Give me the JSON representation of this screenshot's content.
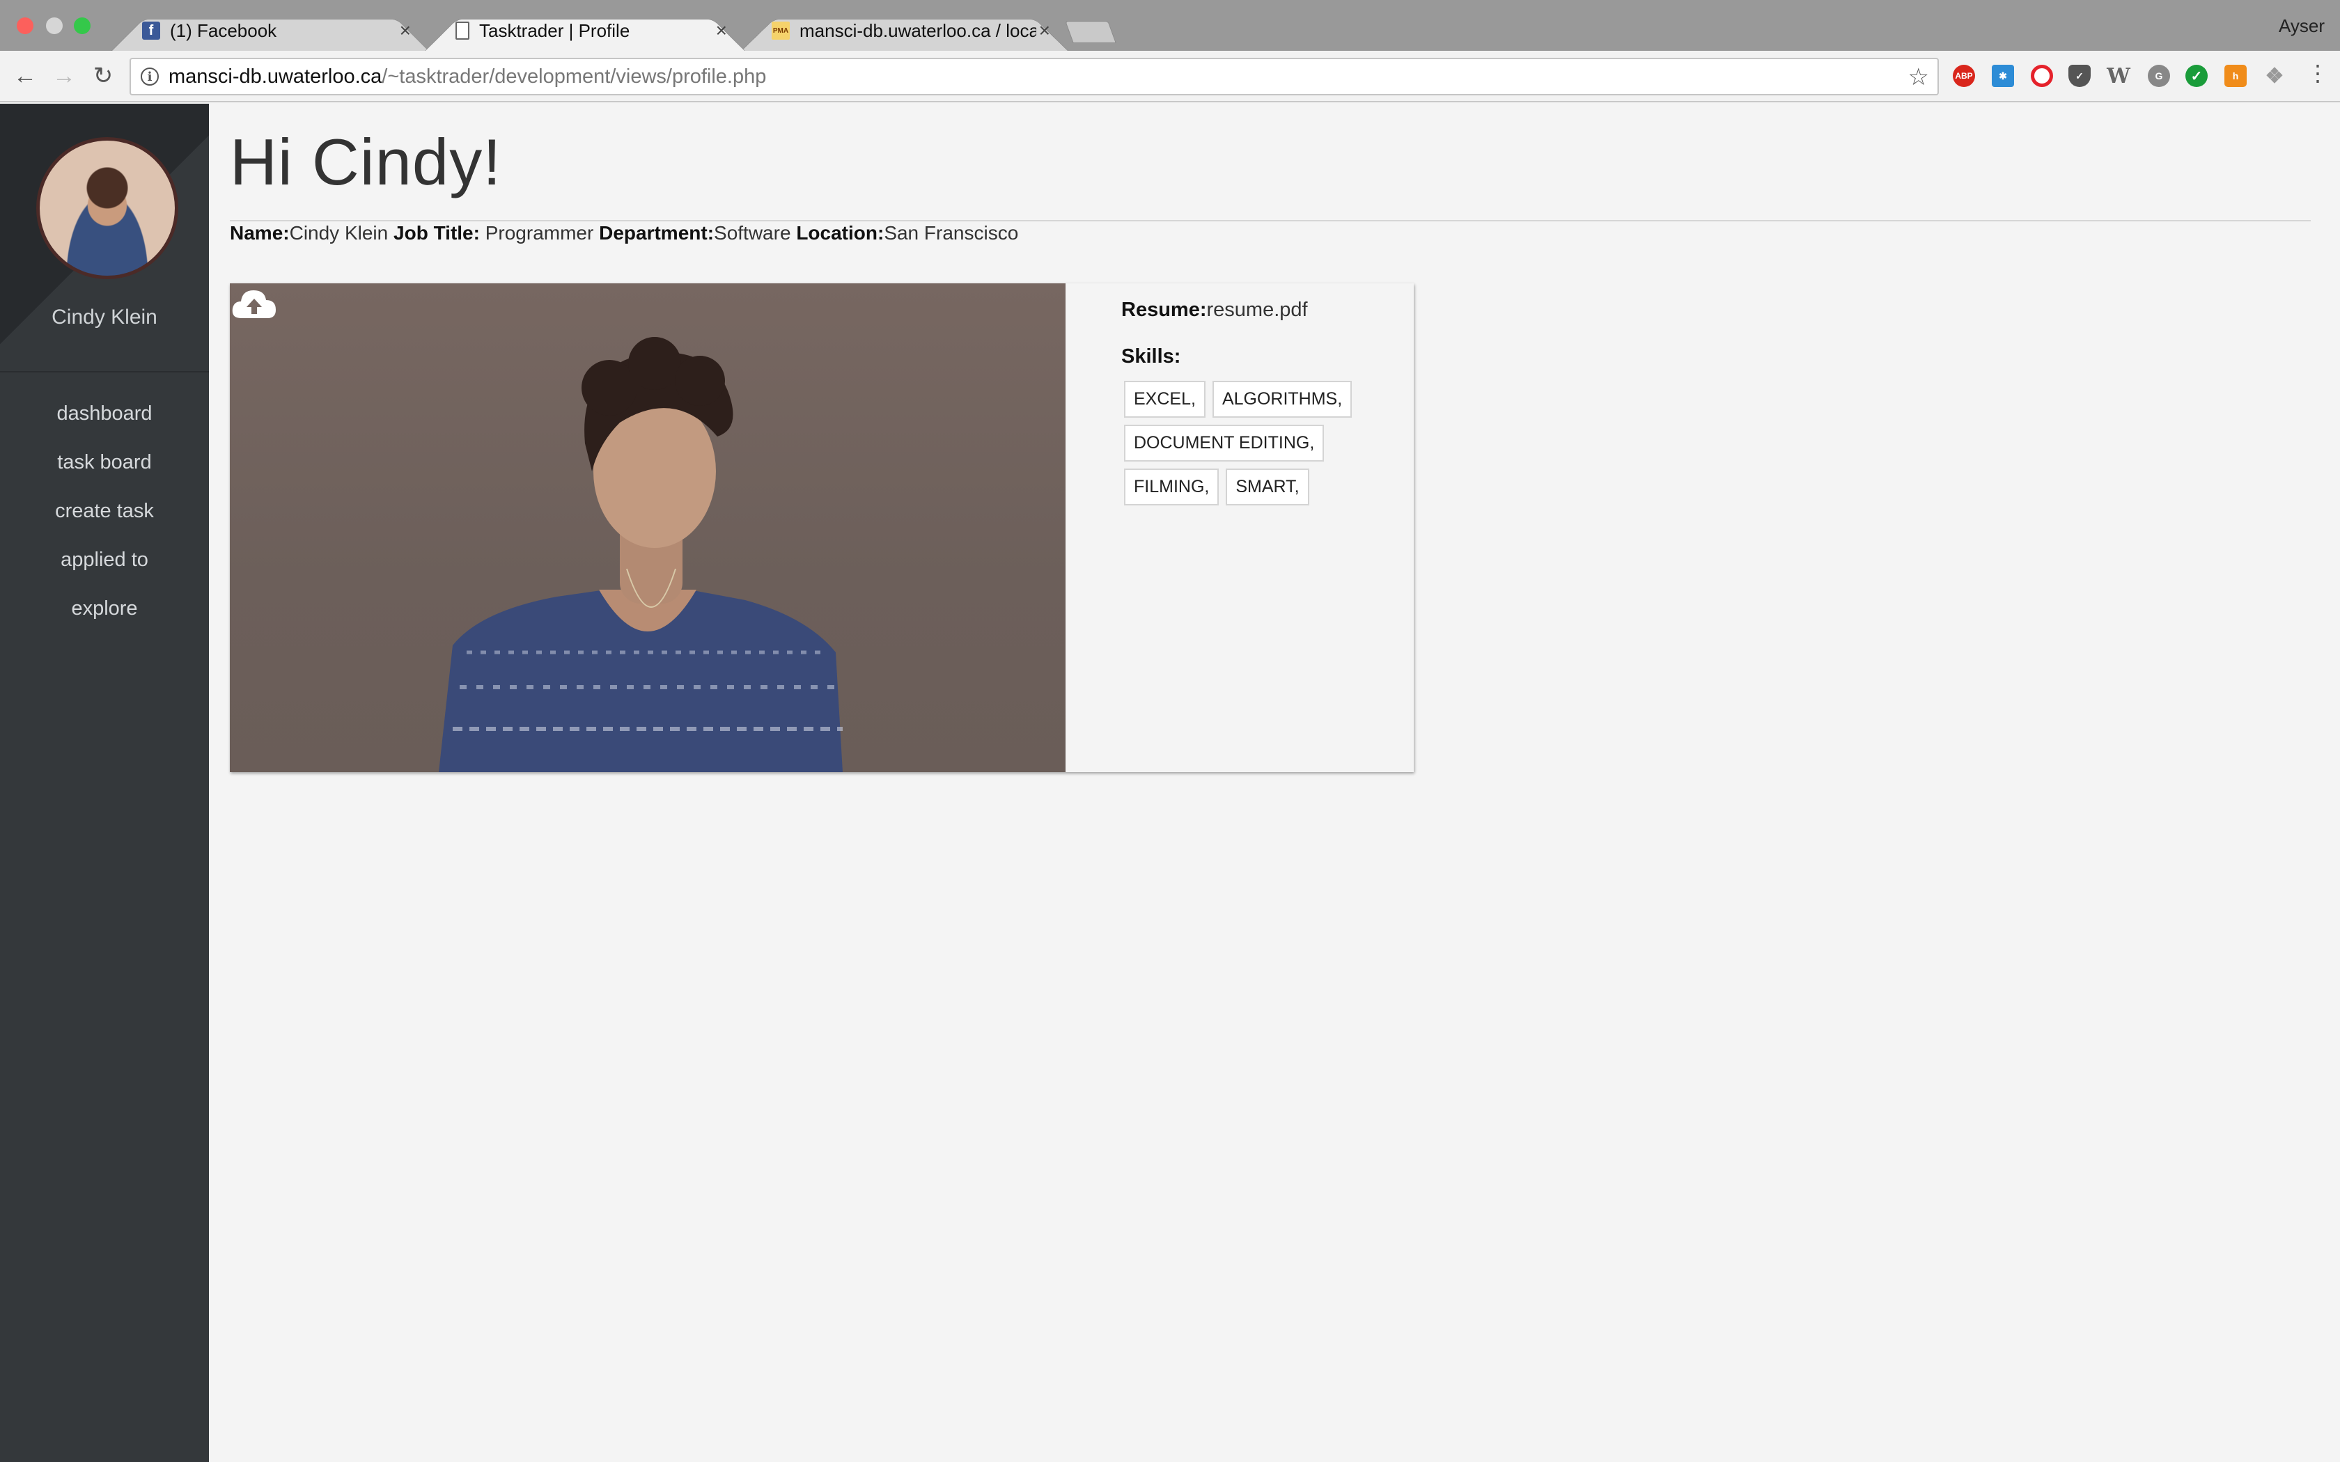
{
  "browser": {
    "tabs": [
      {
        "title": "(1) Facebook",
        "favicon": "facebook-icon",
        "close": "×"
      },
      {
        "title": "Tasktrader | Profile",
        "favicon": "document-icon",
        "close": "×"
      },
      {
        "title": "mansci-db.uwaterloo.ca / local",
        "favicon": "phpmyadmin-icon",
        "close": "×"
      }
    ],
    "profile_name": "Ayser",
    "url_host": "mansci-db.uwaterloo.ca",
    "url_path": "/~tasktrader/development/views/profile.php",
    "info_glyph": "i"
  },
  "sidebar": {
    "user_name": "Cindy Klein",
    "items": [
      {
        "label": "dashboard"
      },
      {
        "label": "task board"
      },
      {
        "label": "create task"
      },
      {
        "label": "applied to"
      },
      {
        "label": "explore"
      }
    ]
  },
  "main": {
    "greeting": "Hi Cindy!",
    "info": {
      "name_label": "Name:",
      "name_value": "Cindy Klein",
      "job_label": "Job Title:",
      "job_value": " Programmer",
      "dept_label": "Department:",
      "dept_value": "Software",
      "loc_label": "Location:",
      "loc_value": "San Franscisco"
    },
    "card": {
      "resume_label": "Resume:",
      "resume_value": "resume.pdf",
      "skills_label": "Skills:",
      "skills": [
        "EXCEL,",
        "ALGORITHMS,",
        "DOCUMENT EDITING,",
        "FILMING,",
        "SMART,"
      ]
    }
  },
  "colors": {
    "sidebar_bg": "#34383b",
    "page_bg": "#f4f4f4",
    "tabstrip_bg": "#999999"
  }
}
